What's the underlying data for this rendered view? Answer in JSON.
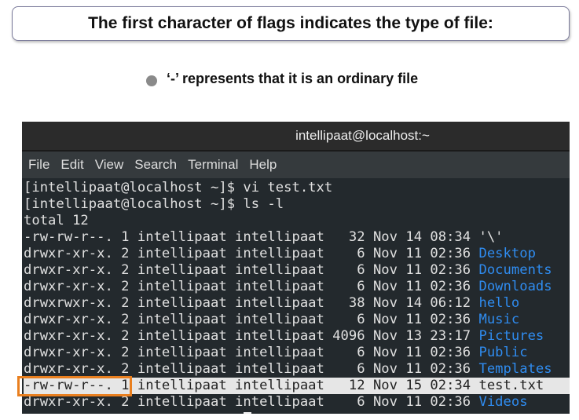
{
  "heading": "The first character of flags indicates the type of file:",
  "bullet": "‘-’ represents that it is an ordinary file",
  "terminal": {
    "title": "intellipaat@localhost:~",
    "menu": [
      "File",
      "Edit",
      "View",
      "Search",
      "Terminal",
      "Help"
    ],
    "lines": [
      "[intellipaat@localhost ~]$ vi test.txt",
      "[intellipaat@localhost ~]$ ls -l",
      "total 12"
    ],
    "rows": [
      {
        "info": "-rw-rw-r--. 1 intellipaat intellipaat   32 Nov 14 08:34 ",
        "name": "'\\'"
      },
      {
        "info": "drwxr-xr-x. 2 intellipaat intellipaat    6 Nov 11 02:36 ",
        "name": "Desktop"
      },
      {
        "info": "drwxr-xr-x. 2 intellipaat intellipaat    6 Nov 11 02:36 ",
        "name": "Documents"
      },
      {
        "info": "drwxr-xr-x. 2 intellipaat intellipaat    6 Nov 11 02:36 ",
        "name": "Downloads"
      },
      {
        "info": "drwxrwxr-x. 2 intellipaat intellipaat   38 Nov 14 06:12 ",
        "name": "hello"
      },
      {
        "info": "drwxr-xr-x. 2 intellipaat intellipaat    6 Nov 11 02:36 ",
        "name": "Music"
      },
      {
        "info": "drwxr-xr-x. 2 intellipaat intellipaat 4096 Nov 13 23:17 ",
        "name": "Pictures"
      },
      {
        "info": "drwxr-xr-x. 2 intellipaat intellipaat    6 Nov 11 02:36 ",
        "name": "Public"
      },
      {
        "info": "drwxr-xr-x. 2 intellipaat intellipaat    6 Nov 11 02:36 ",
        "name": "Templates"
      },
      {
        "info": "-rw-rw-r--. 1 intellipaat intellipaat   12 Nov 15 02:34 ",
        "name": "test.txt"
      },
      {
        "info": "drwxr-xr-x. 2 intellipaat intellipaat    6 Nov 11 02:36 ",
        "name": "Videos"
      }
    ]
  }
}
